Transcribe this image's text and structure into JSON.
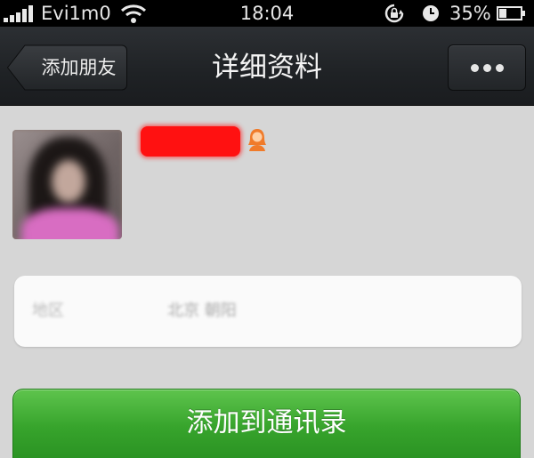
{
  "status_bar": {
    "carrier": "Evi1m0",
    "time": "18:04",
    "battery_percent": "35%",
    "battery_level": 0.35,
    "signal_bars": 5,
    "icons": [
      "signal-icon",
      "wifi-icon",
      "rotation-lock-icon",
      "alarm-icon",
      "battery-icon"
    ]
  },
  "nav": {
    "back_label": "添加朋友",
    "title": "详细资料",
    "more_icon": "more-dots-icon"
  },
  "profile": {
    "avatar": "avatar-photo",
    "name": "",
    "gender_icon": "female-icon",
    "colors": {
      "redaction": "#ff1111",
      "gender": "#f07b2a"
    }
  },
  "region": {
    "label": "地区",
    "value": "北京 朝阳"
  },
  "actions": {
    "add_to_contacts": "添加到通讯录",
    "accent": "#37a42c"
  }
}
